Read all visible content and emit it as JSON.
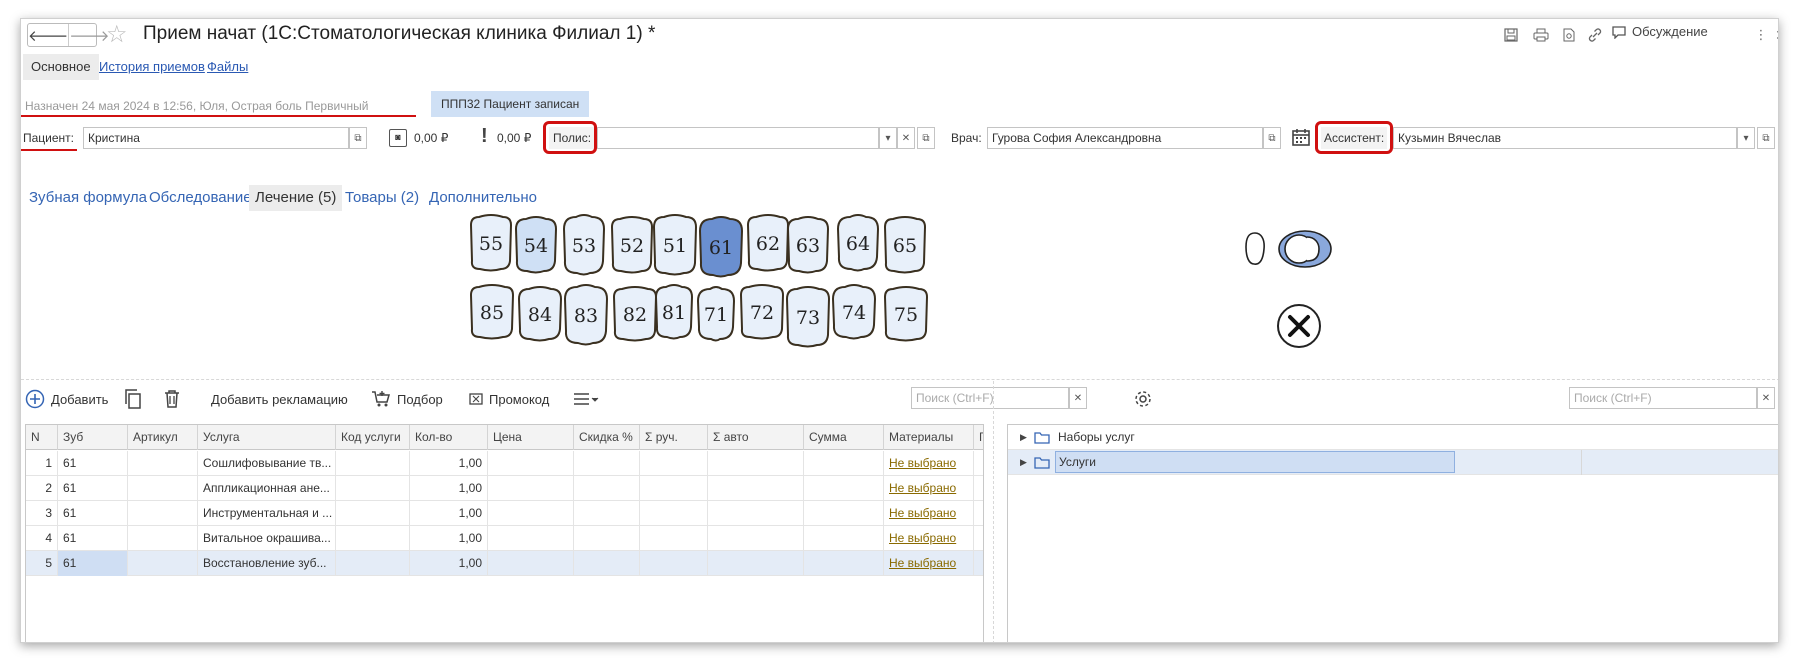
{
  "window": {
    "title": "Прием начат (1С:Стоматологическая клиника Филиал 1) *",
    "discuss_label": "Обсуждение"
  },
  "section_tabs": {
    "main": "Основное",
    "history": "История приемов",
    "files": "Файлы"
  },
  "status": {
    "text": "Назначен 24 мая 2024  в 12:56, Юля, Острая боль    Первичный",
    "badge": "ППП32  Пациент записан"
  },
  "patient_row": {
    "patient_label": "Пациент:",
    "patient_value": "Кристина",
    "balance1": "0,00 ₽",
    "balance2": "0,00 ₽",
    "policy_label": "Полис:",
    "policy_value": "",
    "doctor_label": "Врач:",
    "doctor_value": "Гурова София Александровна",
    "assistant_label": "Ассистент:",
    "assistant_value": "Кузьмин Вячеслав"
  },
  "chart_tabs": [
    "Зубная формула",
    "Обследование",
    "Лечение (5)",
    "Товары (2)",
    "Дополнительно"
  ],
  "teeth": {
    "upper": [
      "55",
      "54",
      "53",
      "52",
      "51",
      "61",
      "62",
      "63",
      "64",
      "65"
    ],
    "lower": [
      "85",
      "84",
      "83",
      "82",
      "81",
      "71",
      "72",
      "73",
      "74",
      "75"
    ],
    "selected": "61",
    "highlighted": "54"
  },
  "toolbar": {
    "add": "Добавить",
    "add_claim": "Добавить рекламацию",
    "pick": "Подбор",
    "promo": "Промокод",
    "search_placeholder": "Поиск (Ctrl+F)",
    "search_placeholder_right": "Поиск (Ctrl+F)"
  },
  "table": {
    "columns": [
      "N",
      "Зуб",
      "Артикул",
      "Услуга",
      "Код услуги",
      "Кол-во",
      "Цена",
      "Скидка %",
      "Σ руч.",
      "Σ авто",
      "Сумма",
      "Материалы",
      "Гара"
    ],
    "rows": [
      {
        "n": "1",
        "tooth": "61",
        "service": "Сошлифовывание тв...",
        "qty": "1,00",
        "materials": "Не выбрано"
      },
      {
        "n": "2",
        "tooth": "61",
        "service": "Аппликационная ане...",
        "qty": "1,00",
        "materials": "Не выбрано"
      },
      {
        "n": "3",
        "tooth": "61",
        "service": "Инструментальная и ...",
        "qty": "1,00",
        "materials": "Не выбрано"
      },
      {
        "n": "4",
        "tooth": "61",
        "service": "Витальное окрашива...",
        "qty": "1,00",
        "materials": "Не выбрано"
      },
      {
        "n": "5",
        "tooth": "61",
        "service": "Восстановление зуб...",
        "qty": "1,00",
        "materials": "Не выбрано"
      }
    ]
  },
  "tree": {
    "items": [
      "Наборы услуг",
      "Услуги"
    ]
  },
  "colors": {
    "accent_red": "#d01010",
    "tooth_selected": "#6a8fd0",
    "tooth_highlight": "#cfe0f5",
    "link": "#2a59b3"
  }
}
